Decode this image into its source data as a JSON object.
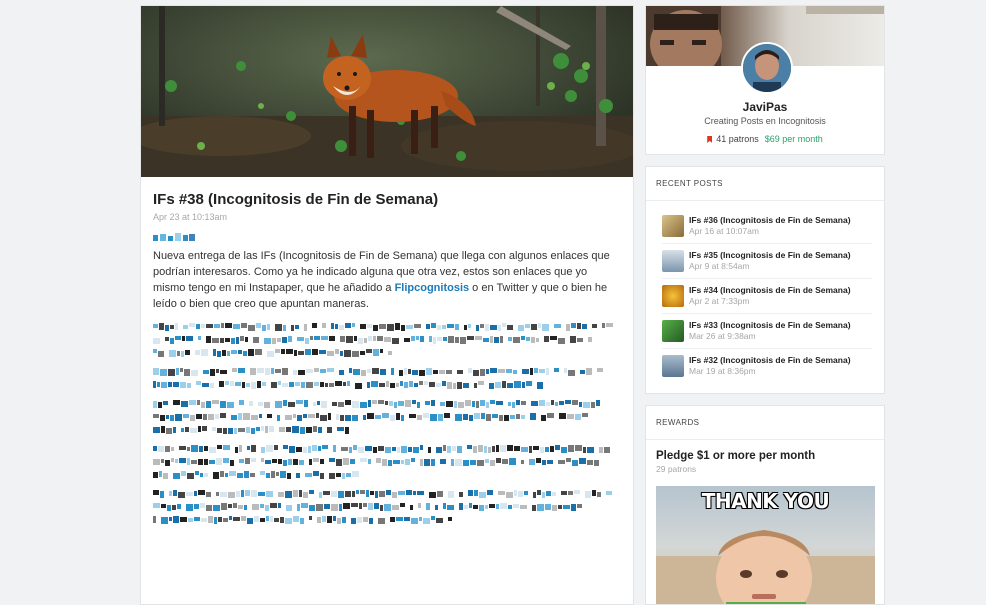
{
  "post": {
    "title": "IFs #38 (Incognitosis de Fin de Semana)",
    "date": "Apr 23 at 10:13am",
    "intro_before_link": "Nueva entrega de las IFs (Incognitosis de Fin de Semana) que llega con algunos enlaces que podrían interesaros.  Como ya he indicado alguna que otra vez, estos son enlaces que yo mismo tengo en mi Instapaper, que he añadido a ",
    "intro_link": "Flipcognitosis",
    "intro_after_link": " o en Twitter y que o bien he leído o bien que creo que apuntan maneras."
  },
  "creator": {
    "name": "JaviPas",
    "tagline": "Creating Posts en Incognitosis",
    "patrons": "41 patrons",
    "monthly": "$69 per month",
    "icon": "bookmark-icon"
  },
  "recent_posts": {
    "header": "RECENT POSTS",
    "items": [
      {
        "title": "IFs #36 (Incognitosis de Fin de Semana)",
        "date": "Apr 16 at 10:07am",
        "thumb_color": "#c8a45a"
      },
      {
        "title": "IFs #35 (Incognitosis de Fin de Semana)",
        "date": "Apr 9 at 8:54am",
        "thumb_color": "#8ea3b8"
      },
      {
        "title": "IFs #34 (Incognitosis de Fin de Semana)",
        "date": "Apr 2 at 7:33pm",
        "thumb_color": "#e59a1a"
      },
      {
        "title": "IFs #33 (Incognitosis de Fin de Semana)",
        "date": "Mar 26 at 9:38am",
        "thumb_color": "#3f8f3a"
      },
      {
        "title": "IFs #32 (Incognitosis de Fin de Semana)",
        "date": "Mar 19 at 8:36pm",
        "thumb_color": "#6f8fab"
      }
    ]
  },
  "rewards": {
    "header": "REWARDS",
    "title": "Pledge $1 or more per month",
    "count": "29 patrons",
    "image_caption": "THANK YOU"
  },
  "colors": {
    "link": "#1b7bb9",
    "money": "#2aa36b",
    "bookmark": "#e0341f"
  }
}
